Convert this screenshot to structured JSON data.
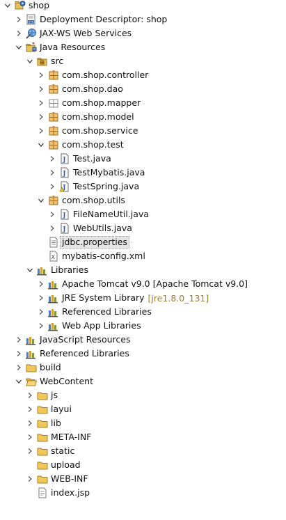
{
  "tree": [
    {
      "label": "shop",
      "level": 0,
      "toggle": "expanded",
      "icon": "project-icon",
      "name": "project-shop",
      "interactable": true
    },
    {
      "label": "Deployment Descriptor: shop",
      "level": 1,
      "toggle": "collapsed",
      "icon": "deployment-descriptor-icon",
      "name": "deployment-descriptor",
      "interactable": true
    },
    {
      "label": "JAX-WS Web Services",
      "level": 1,
      "toggle": "collapsed",
      "icon": "web-services-icon",
      "name": "jax-ws-web-services",
      "interactable": true
    },
    {
      "label": "Java Resources",
      "level": 1,
      "toggle": "expanded",
      "icon": "java-resources-icon",
      "name": "java-resources",
      "interactable": true
    },
    {
      "label": "src",
      "level": 2,
      "toggle": "expanded",
      "icon": "source-folder-icon",
      "name": "src-folder",
      "interactable": true
    },
    {
      "label": "com.shop.controller",
      "level": 3,
      "toggle": "collapsed",
      "icon": "package-icon",
      "name": "package-controller",
      "interactable": true
    },
    {
      "label": "com.shop.dao",
      "level": 3,
      "toggle": "collapsed",
      "icon": "package-icon",
      "name": "package-dao",
      "interactable": true
    },
    {
      "label": "com.shop.mapper",
      "level": 3,
      "toggle": "collapsed",
      "icon": "package-empty-icon",
      "name": "package-mapper",
      "interactable": true
    },
    {
      "label": "com.shop.model",
      "level": 3,
      "toggle": "collapsed",
      "icon": "package-icon",
      "name": "package-model",
      "interactable": true
    },
    {
      "label": "com.shop.service",
      "level": 3,
      "toggle": "collapsed",
      "icon": "package-icon",
      "name": "package-service",
      "interactable": true
    },
    {
      "label": "com.shop.test",
      "level": 3,
      "toggle": "expanded",
      "icon": "package-icon",
      "name": "package-test",
      "interactable": true
    },
    {
      "label": "Test.java",
      "level": 4,
      "toggle": "collapsed",
      "icon": "java-file-icon",
      "name": "file-test-java",
      "interactable": true
    },
    {
      "label": "TestMybatis.java",
      "level": 4,
      "toggle": "collapsed",
      "icon": "java-file-icon",
      "name": "file-testmybatis-java",
      "interactable": true
    },
    {
      "label": "TestSpring.java",
      "level": 4,
      "toggle": "collapsed",
      "icon": "java-file-warning-icon",
      "name": "file-testspring-java",
      "interactable": true
    },
    {
      "label": "com.shop.utils",
      "level": 3,
      "toggle": "expanded",
      "icon": "package-icon",
      "name": "package-utils",
      "interactable": true
    },
    {
      "label": "FileNameUtil.java",
      "level": 4,
      "toggle": "collapsed",
      "icon": "java-file-icon",
      "name": "file-filenameutil-java",
      "interactable": true
    },
    {
      "label": "WebUtils.java",
      "level": 4,
      "toggle": "collapsed",
      "icon": "java-file-icon",
      "name": "file-webutils-java",
      "interactable": true
    },
    {
      "label": "jdbc.properties",
      "level": 3,
      "toggle": "none",
      "icon": "properties-file-icon",
      "name": "file-jdbc-properties",
      "interactable": true,
      "selected": true
    },
    {
      "label": "mybatis-config.xml",
      "level": 3,
      "toggle": "none",
      "icon": "xml-file-icon",
      "name": "file-mybatis-config-xml",
      "interactable": true
    },
    {
      "label": "Libraries",
      "level": 2,
      "toggle": "expanded",
      "icon": "libraries-icon",
      "name": "libraries",
      "interactable": true
    },
    {
      "label": "Apache Tomcat v9.0 [Apache Tomcat v9.0]",
      "level": 3,
      "toggle": "collapsed",
      "icon": "library-icon",
      "name": "lib-apache-tomcat",
      "interactable": true
    },
    {
      "label": "JRE System Library",
      "decoration": "[jre1.8.0_131]",
      "level": 3,
      "toggle": "collapsed",
      "icon": "library-icon",
      "name": "lib-jre-system",
      "interactable": true
    },
    {
      "label": "Referenced Libraries",
      "level": 3,
      "toggle": "collapsed",
      "icon": "library-icon",
      "name": "lib-referenced",
      "interactable": true
    },
    {
      "label": "Web App Libraries",
      "level": 3,
      "toggle": "collapsed",
      "icon": "library-icon",
      "name": "lib-web-app",
      "interactable": true
    },
    {
      "label": "JavaScript Resources",
      "level": 1,
      "toggle": "collapsed",
      "icon": "library-icon",
      "name": "javascript-resources",
      "interactable": true
    },
    {
      "label": "Referenced Libraries",
      "level": 1,
      "toggle": "collapsed",
      "icon": "library-icon",
      "name": "referenced-libraries",
      "interactable": true
    },
    {
      "label": "build",
      "level": 1,
      "toggle": "collapsed",
      "icon": "folder-icon",
      "name": "folder-build",
      "interactable": true
    },
    {
      "label": "WebContent",
      "level": 1,
      "toggle": "expanded",
      "icon": "folder-open-icon",
      "name": "folder-webcontent",
      "interactable": true
    },
    {
      "label": "js",
      "level": 2,
      "toggle": "collapsed",
      "icon": "folder-icon",
      "name": "folder-js",
      "interactable": true
    },
    {
      "label": "layui",
      "level": 2,
      "toggle": "collapsed",
      "icon": "folder-icon",
      "name": "folder-layui",
      "interactable": true
    },
    {
      "label": "lib",
      "level": 2,
      "toggle": "collapsed",
      "icon": "folder-icon",
      "name": "folder-lib",
      "interactable": true
    },
    {
      "label": "META-INF",
      "level": 2,
      "toggle": "collapsed",
      "icon": "folder-icon",
      "name": "folder-meta-inf",
      "interactable": true
    },
    {
      "label": "static",
      "level": 2,
      "toggle": "collapsed",
      "icon": "folder-icon",
      "name": "folder-static",
      "interactable": true
    },
    {
      "label": "upload",
      "level": 2,
      "toggle": "none",
      "icon": "folder-icon",
      "name": "folder-upload",
      "interactable": true
    },
    {
      "label": "WEB-INF",
      "level": 2,
      "toggle": "collapsed",
      "icon": "folder-icon",
      "name": "folder-web-inf",
      "interactable": true
    },
    {
      "label": "index.jsp",
      "level": 2,
      "toggle": "none",
      "icon": "jsp-file-icon",
      "name": "file-index-jsp",
      "interactable": true
    }
  ],
  "colors": {
    "package": "#c98a2c",
    "folder": "#e8b94a",
    "java_blue": "#2b5fa8",
    "library": "#8b6b2a",
    "decoration": "#a08030"
  }
}
